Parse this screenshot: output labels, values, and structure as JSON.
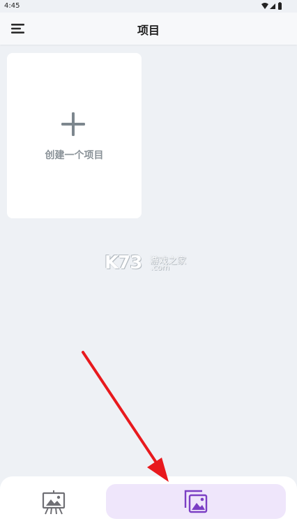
{
  "status_bar": {
    "time": "4:45"
  },
  "header": {
    "title": "项目",
    "menu_icon": "hamburger-menu-icon"
  },
  "main": {
    "create_card": {
      "label": "创建一个项目",
      "icon": "plus-icon"
    }
  },
  "watermark": {
    "logo": "K73",
    "name": "游戏之家",
    "domain": ".com"
  },
  "bottom_nav": {
    "items": [
      {
        "icon": "easel-presentation-icon",
        "selected": false
      },
      {
        "icon": "image-gallery-icon",
        "selected": true
      }
    ]
  },
  "colors": {
    "background": "#eef1f5",
    "card": "#ffffff",
    "accent": "#7b3fc4",
    "selected_pill": "#efe6fb",
    "annotation_arrow": "#e8191d"
  }
}
